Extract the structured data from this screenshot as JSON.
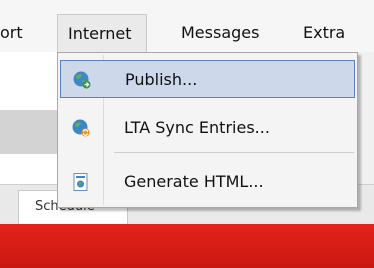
{
  "menubar": {
    "items": [
      {
        "label": "ort"
      },
      {
        "label": "Internet",
        "active": true
      },
      {
        "label": "Messages"
      },
      {
        "label": "Extra"
      }
    ]
  },
  "background": {
    "tab_label": "Schedule",
    "accent_color": "#e2231a"
  },
  "internet_menu": {
    "items": [
      {
        "label": "Publish...",
        "icon": "globe-publish-icon",
        "highlighted": true
      },
      {
        "label": "LTA Sync Entries...",
        "icon": "globe-sync-icon"
      },
      {
        "label": "Generate HTML...",
        "icon": "html-document-icon"
      }
    ]
  }
}
